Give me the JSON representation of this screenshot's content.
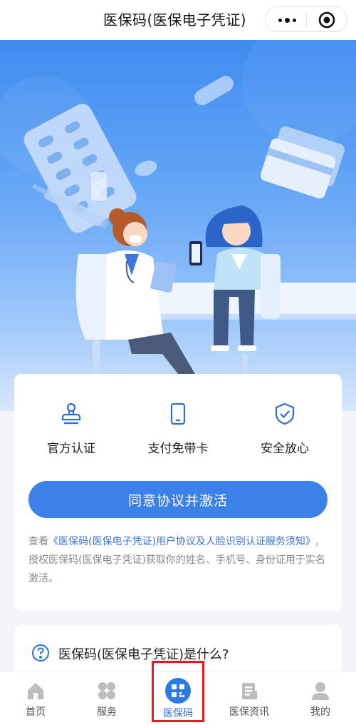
{
  "header": {
    "title": "医保码(医保电子凭证)",
    "more_icon": "more-dots-icon",
    "close_icon": "target-circle-icon"
  },
  "hero": {
    "illustration": "doctor-patient-scene"
  },
  "features": [
    {
      "icon": "stamp-icon",
      "label": "官方认证"
    },
    {
      "icon": "phone-icon",
      "label": "支付免带卡"
    },
    {
      "icon": "shield-check-icon",
      "label": "安全放心"
    }
  ],
  "activate_button": "同意协议并激活",
  "notice": {
    "prefix": "查看",
    "link": "《医保码(医保电子凭证)用户协议及人脸识别认证服务须知》",
    "suffix": ",授权医保码(医保电子凭证)获取你的姓名、手机号、身份证用于实名激活。"
  },
  "faq": {
    "icon": "question-circle-icon",
    "title": "医保码(医保电子凭证)是什么?"
  },
  "tabs": [
    {
      "icon": "home-icon",
      "label": "首页"
    },
    {
      "icon": "grid-icon",
      "label": "服务"
    },
    {
      "icon": "qrcode-icon",
      "label": "医保码",
      "active": true
    },
    {
      "icon": "news-icon",
      "label": "医保资讯"
    },
    {
      "icon": "person-icon",
      "label": "我的"
    }
  ],
  "colors": {
    "primary": "#3b82e8",
    "link": "#3b73d6",
    "highlight": "#e31b1b"
  }
}
